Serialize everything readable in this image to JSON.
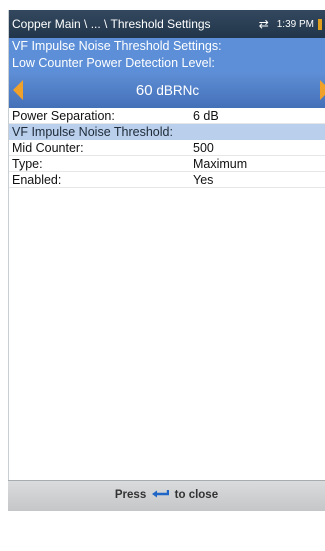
{
  "status_bar": {
    "breadcrumb": "Copper Main \\ ... \\ Threshold Settings",
    "time": "1:39 PM",
    "icons": [
      "swap-icon",
      "battery-icon"
    ]
  },
  "settings_header": "VF Impulse Noise Threshold Settings:",
  "low_counter": {
    "label": "Low Counter Power Detection Level:",
    "value_number": "60",
    "value_unit": "dBRNc"
  },
  "power_separation": {
    "label": "Power Separation:",
    "value": "6 dB"
  },
  "threshold_header": "VF Impulse Noise Threshold:",
  "rows": [
    {
      "label": "Mid Counter:",
      "value": "500"
    },
    {
      "label": "Type:",
      "value": "Maximum"
    },
    {
      "label": "Enabled:",
      "value": "Yes"
    }
  ],
  "footer": {
    "press": "Press",
    "to_close": "to close"
  },
  "colors": {
    "header_blue": "#5c8fd7",
    "section_light": "#b9cfeb",
    "arrow_orange": "#f0a12a",
    "status_bar": "#2b3f55"
  }
}
